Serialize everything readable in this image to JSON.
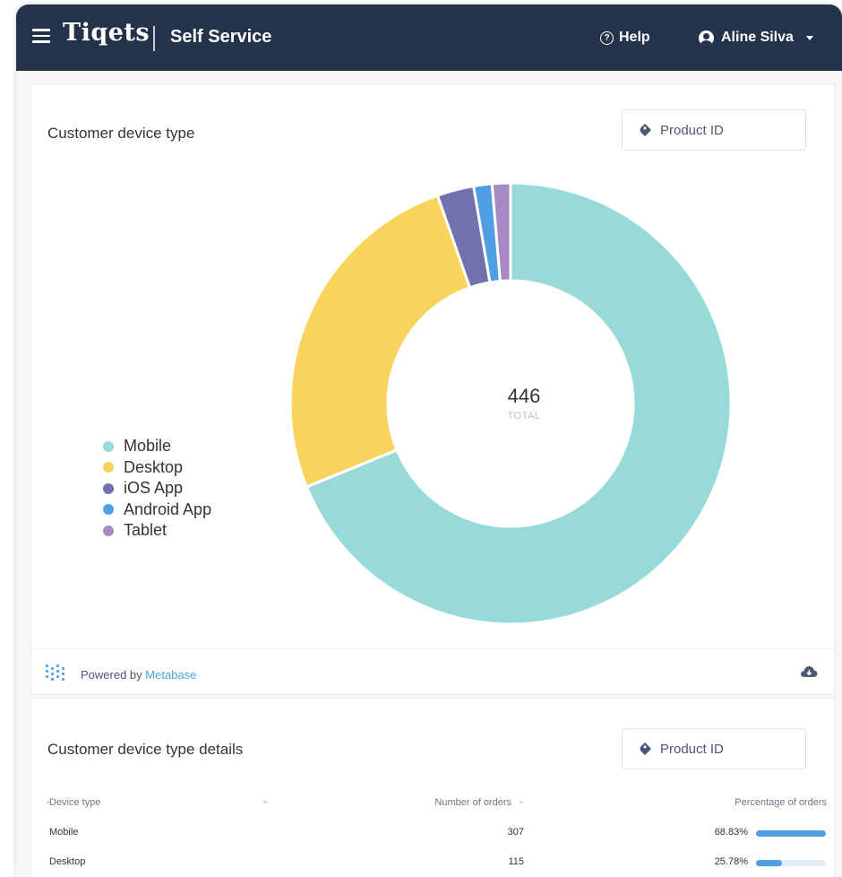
{
  "header": {
    "logo": "Tiqets",
    "app_name": "Self Service",
    "help_label": "Help",
    "user_name": "Aline Silva"
  },
  "device_card": {
    "title": "Customer device type",
    "filter_label": "Product ID",
    "total_value": "446",
    "total_label": "TOTAL"
  },
  "chart_data": {
    "type": "pie",
    "categories": [
      "Mobile",
      "Desktop",
      "iOS App",
      "Android App",
      "Tablet"
    ],
    "values": [
      307,
      115,
      12,
      6,
      6
    ],
    "colors": [
      "#98d9d9",
      "#f9d45c",
      "#7172ad",
      "#509ee3",
      "#a989c5"
    ],
    "total": 446,
    "legend_position": "left"
  },
  "footer": {
    "powered_prefix": "Powered by",
    "powered_brand": "Metabase"
  },
  "details_card": {
    "title": "Customer device type details",
    "filter_label": "Product ID",
    "columns": [
      "Device type",
      "Number of orders",
      "Percentage of orders"
    ],
    "rows": [
      {
        "device": "Mobile",
        "orders": "307",
        "percentage": "68.83%",
        "fraction": 1.0
      },
      {
        "device": "Desktop",
        "orders": "115",
        "percentage": "25.78%",
        "fraction": 0.375
      }
    ]
  }
}
